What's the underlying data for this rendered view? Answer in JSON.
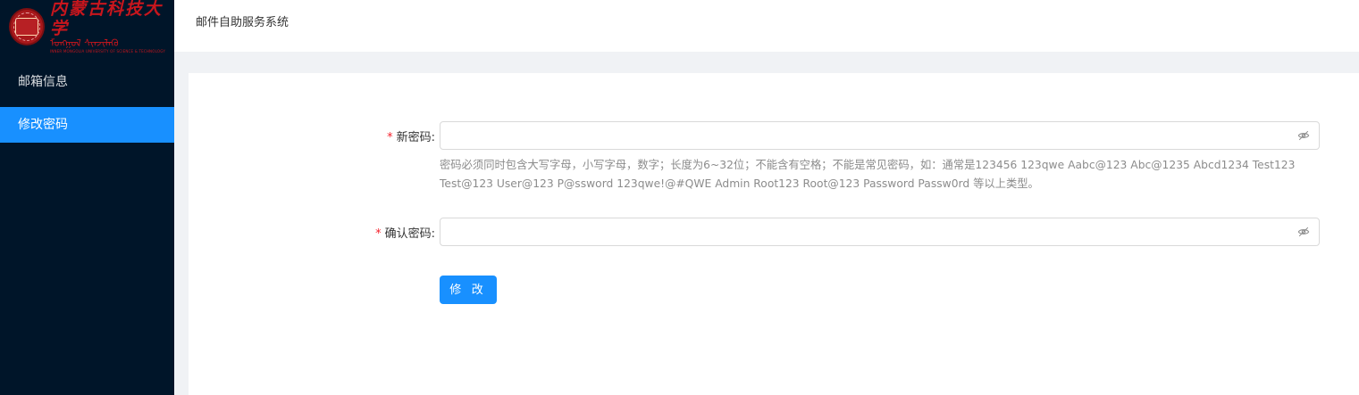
{
  "logo": {
    "cn": "内蒙古科技大学",
    "mn": "ᠮᠣᠩᠭᠣᠯ ᠰᠢᠨᠵᠢᠯᠡᠬᠦ",
    "en": "INNER MONGOLIA UNIVERSITY OF SCIENCE & TECHNOLOGY"
  },
  "sidebar": {
    "items": [
      {
        "label": "邮箱信息"
      },
      {
        "label": "修改密码"
      }
    ],
    "active_color": "#1890ff",
    "bg_color": "#001529"
  },
  "header": {
    "title": "邮件自助服务系统"
  },
  "form": {
    "required_mark": "*",
    "new_password": {
      "label": "新密码",
      "colon": ":",
      "value": "",
      "icon": "eye-invisible-icon",
      "help": "密码必须同时包含大写字母，小写字母，数字；长度为6~32位；不能含有空格；不能是常见密码，如：通常是123456 123qwe Aabc@123 Abc@1235 Abcd1234 Test123 Test@123 User@123 P@ssword 123qwe!@#QWE Admin Root123 Root@123 Password Passw0rd 等以上类型。"
    },
    "confirm_password": {
      "label": "确认密码",
      "colon": ":",
      "value": "",
      "icon": "eye-invisible-icon"
    },
    "submit_label": "修 改"
  }
}
